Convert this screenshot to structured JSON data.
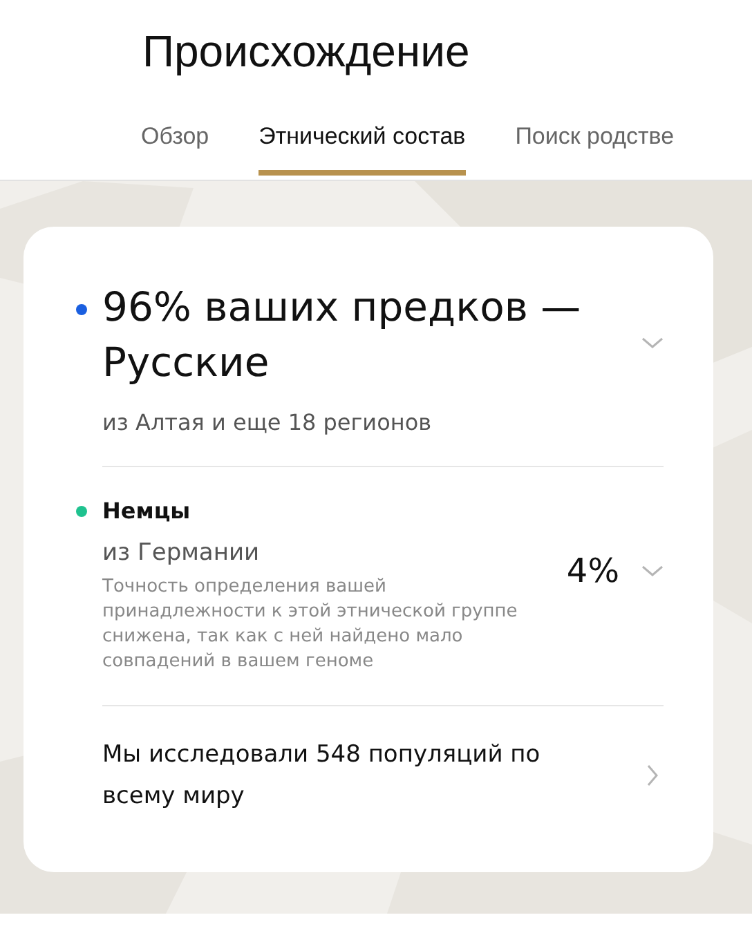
{
  "title": "Происхождение",
  "tabs": [
    {
      "label": "Обзор",
      "selected": false
    },
    {
      "label": "Этнический состав",
      "selected": true
    },
    {
      "label": "Поиск родстве",
      "selected": false
    }
  ],
  "groups": [
    {
      "kind": "main",
      "color": "#1a5fe0",
      "title": "96% ваших предков — Русские",
      "subtitle": "из Алтая и еще 18 регионов",
      "expanded": false
    },
    {
      "kind": "minor",
      "color": "#1fc28f",
      "title": "Немцы",
      "subtitle": "из Германии",
      "note": "Точность определения вашей принадлежности к этой этнической группе снижена, так как с ней найдено мало совпадений в вашем геноме",
      "percent": "4%",
      "expanded": false
    }
  ],
  "link": "Мы исследовали 548 популяций по всему миру"
}
